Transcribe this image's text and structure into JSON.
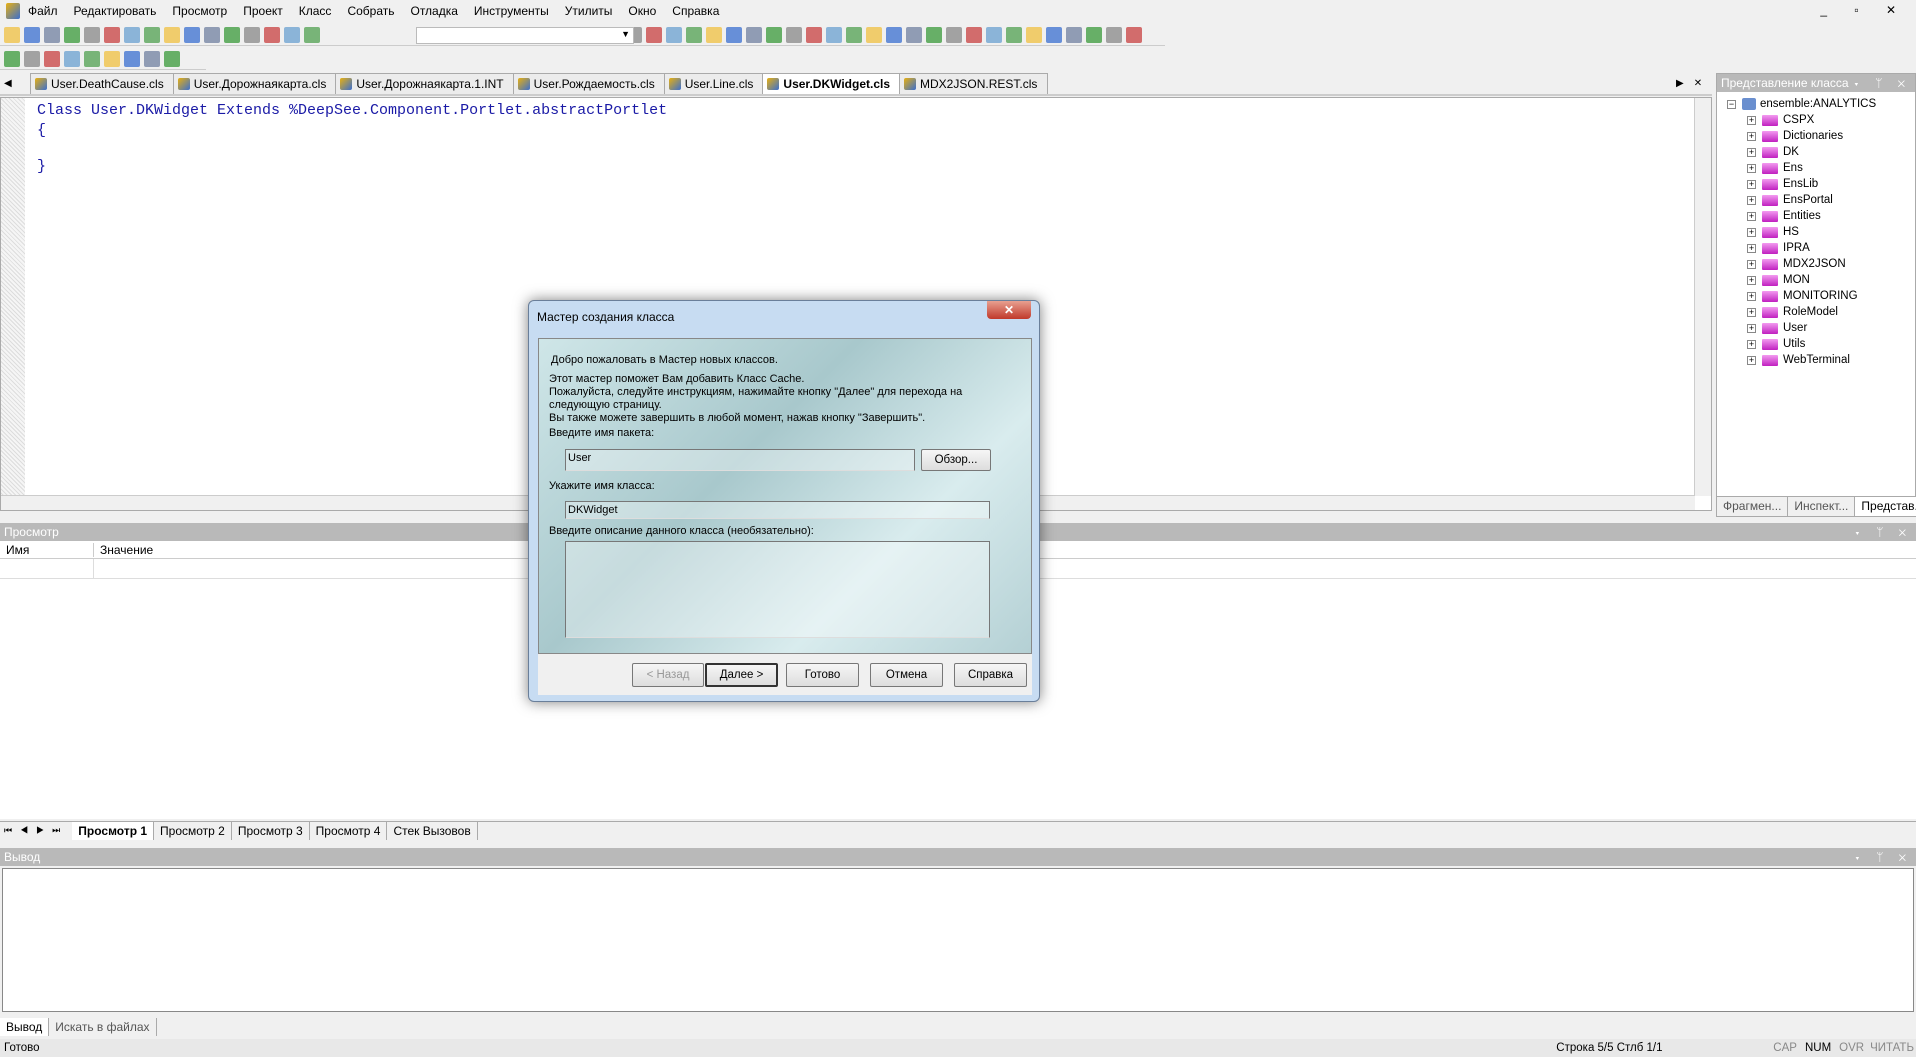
{
  "menu": [
    "Файл",
    "Редактировать",
    "Просмотр",
    "Проект",
    "Класс",
    "Собрать",
    "Отладка",
    "Инструменты",
    "Утилиты",
    "Окно",
    "Справка"
  ],
  "tabs": [
    {
      "label": "User.DeathCause.cls"
    },
    {
      "label": "User.Дорожнаякарта.cls"
    },
    {
      "label": "User.Дорожнаякарта.1.INT"
    },
    {
      "label": "User.Рождаемость.cls"
    },
    {
      "label": "User.Line.cls"
    },
    {
      "label": "User.DKWidget.cls",
      "active": true
    },
    {
      "label": "MDX2JSON.REST.cls"
    }
  ],
  "editor": {
    "lines": [
      "Class User.DKWidget Extends %DeepSee.Component.Portlet.abstractPortlet",
      "{",
      "",
      "}"
    ]
  },
  "class_view": {
    "title": "Представление класса",
    "root": "ensemble:ANALYTICS",
    "items": [
      "CSPX",
      "Dictionaries",
      "DK",
      "Ens",
      "EnsLib",
      "EnsPortal",
      "Entities",
      "HS",
      "IPRA",
      "MDX2JSON",
      "MON",
      "MONITORING",
      "RoleModel",
      "User",
      "Utils",
      "WebTerminal"
    ],
    "tabs": [
      "Фрагмен...",
      "Инспект...",
      "Представ..."
    ]
  },
  "watch": {
    "title": "Просмотр",
    "columns": [
      "Имя",
      "Значение"
    ],
    "tabs": [
      "Просмотр 1",
      "Просмотр 2",
      "Просмотр 3",
      "Просмотр 4",
      "Стек Вызовов"
    ]
  },
  "output": {
    "title": "Вывод",
    "tabs": [
      "Вывод",
      "Искать в файлах"
    ]
  },
  "status": {
    "left": "Готово",
    "position": "Строка 5/5 Стлб 1/1",
    "cap": "CAP",
    "num": "NUM",
    "ovr": "OVR",
    "read": "ЧИТАТЬ"
  },
  "dialog": {
    "title": "Мастер создания класса",
    "welcome": "Добро пожаловать в Мастер новых классов.",
    "intro1": "Этот мастер поможет Вам добавить Класс Cache.",
    "intro2": "Пожалуйста, следуйте инструкциям, нажимайте кнопку \"Далее\" для перехода на следующую страницу.",
    "intro3": "Вы также можете завершить в любой момент, нажав кнопку \"Завершить\".",
    "package_label": "Введите имя пакета:",
    "package_value": "User",
    "browse": "Обзор...",
    "class_label": "Укажите имя класса:",
    "class_value": "DKWidget",
    "desc_label": "Введите описание данного класса (необязательно):",
    "back": "< Назад",
    "next": "Далее >",
    "finish": "Готово",
    "cancel": "Отмена",
    "help": "Справка"
  }
}
